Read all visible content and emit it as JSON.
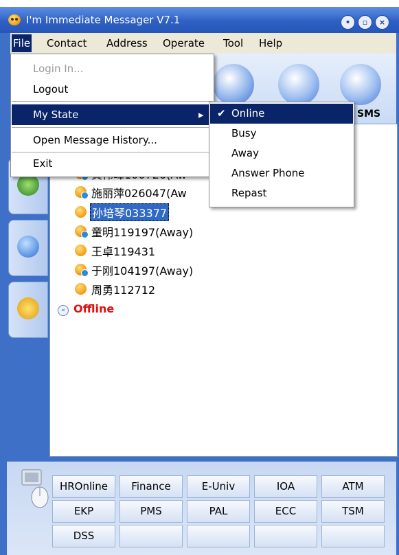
{
  "window": {
    "title": "I'm  Immediate Messager V7.1",
    "controls": [
      "•",
      "▫",
      "×"
    ]
  },
  "menubar": {
    "items": [
      "File",
      "Contact",
      "Address",
      "Operate",
      "Tool",
      "Help"
    ]
  },
  "toolbar": {
    "sms_label": "SMS"
  },
  "file_menu": {
    "items": [
      "Login In...",
      "Logout",
      "My State",
      "Open Message History...",
      "Exit"
    ],
    "arrow": "▸"
  },
  "state_submenu": {
    "items": [
      "Online",
      "Busy",
      "Away",
      "Answer Phone",
      "Repast"
    ],
    "checked": "✔"
  },
  "contacts": [
    {
      "label": "黄伟峰100726(Aw",
      "status": "away"
    },
    {
      "label": "施丽萍026047(Aw",
      "status": "away"
    },
    {
      "label": "孙培琴033377",
      "status": "online",
      "selected": true
    },
    {
      "label": "童明119197(Away)",
      "status": "away"
    },
    {
      "label": "王卓119431",
      "status": "online"
    },
    {
      "label": "于刚104197(Away)",
      "status": "away"
    },
    {
      "label": "周勇112712",
      "status": "online"
    }
  ],
  "offline_group": {
    "label": "Offline",
    "icon": "«"
  },
  "shortcut_buttons": [
    [
      "HROnline",
      "Finance",
      "E-Univ",
      "IOA",
      "ATM"
    ],
    [
      "EKP",
      "PMS",
      "PAL",
      "ECC",
      "TSM"
    ],
    [
      "DSS",
      "",
      "",
      "",
      ""
    ]
  ]
}
